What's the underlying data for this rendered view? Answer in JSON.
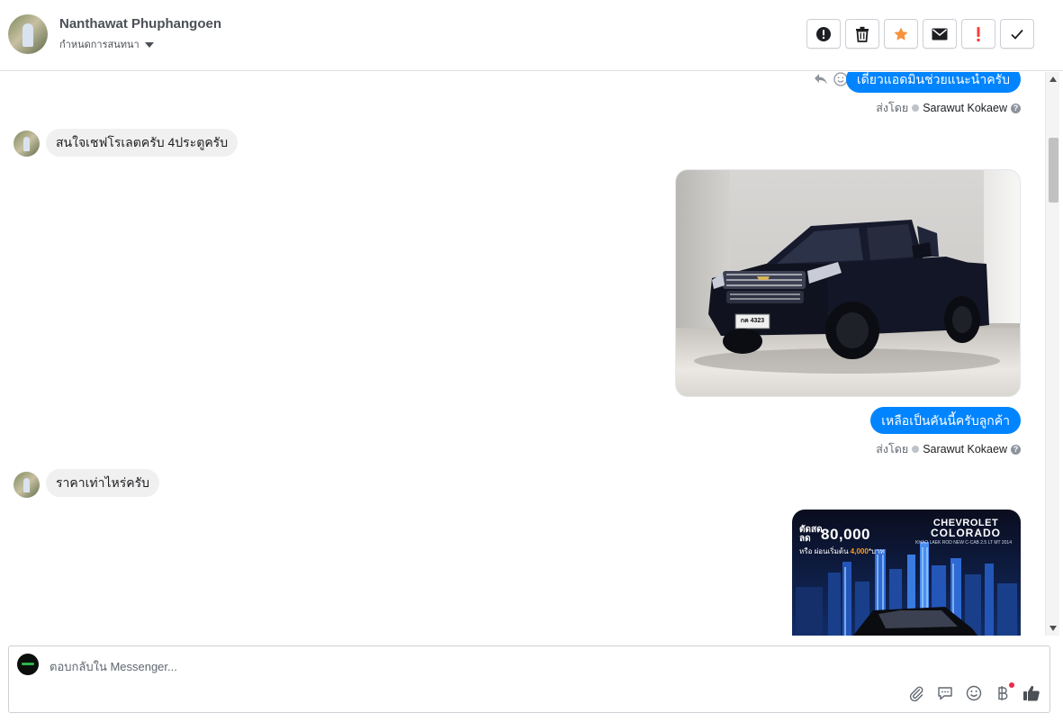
{
  "header": {
    "contact_name": "Nanthawat Phuphangoen",
    "status_label": "กำหนดการสนทนา",
    "toolbar": {
      "report_icon": "alert-circle-icon",
      "delete_icon": "trash-icon",
      "star_icon": "star-icon",
      "mail_icon": "envelope-icon",
      "urgent_icon": "exclamation-icon",
      "done_icon": "check-icon"
    }
  },
  "colors": {
    "bubble_out": "#0084ff",
    "bubble_in": "#f1f0f0",
    "star": "#f7923a",
    "urgent": "#fa3e3e"
  },
  "messages": [
    {
      "direction": "out",
      "text": "เดี๋ยวแอดมินช่วยแนะนำครับ",
      "sent_by_label": "ส่งโดย",
      "sender": "Sarawut Kokaew"
    },
    {
      "direction": "in",
      "text": "สนใจเชฟโรเลตครับ 4ประตูครับ"
    },
    {
      "direction": "out",
      "type": "image",
      "image": "chevrolet-colorado-pickup-photo"
    },
    {
      "direction": "out",
      "text": "เหลือเป็นคันนี้ครับลูกค้า",
      "sent_by_label": "ส่งโดย",
      "sender": "Sarawut Kokaew"
    },
    {
      "direction": "in",
      "text": "ราคาเท่าไหร่ครับ"
    },
    {
      "direction": "out",
      "type": "image",
      "image": "chevrolet-colorado-ad",
      "ad": {
        "brand": "CHEVROLET",
        "model": "COLORADO",
        "subtitle": "KHAO LAEK ROD NEW C-CAB 2.5 LT MT 2014",
        "discount_label_1": "ตัดสด",
        "discount_label_2": "ลด",
        "discount": "80,000",
        "note_prefix": "หรือ",
        "note_middle": "ผ่อนเริ่มต้น",
        "note_amount": "4,000",
        "note_suffix": "*บาท"
      }
    }
  ],
  "car_plate": "กค 4323",
  "reply": {
    "placeholder": "ตอบกลับใน Messenger...",
    "value": "",
    "tools": [
      "paperclip-icon",
      "speech-bubble-icon",
      "smiley-icon",
      "baht-icon",
      "thumbs-up-icon"
    ]
  }
}
